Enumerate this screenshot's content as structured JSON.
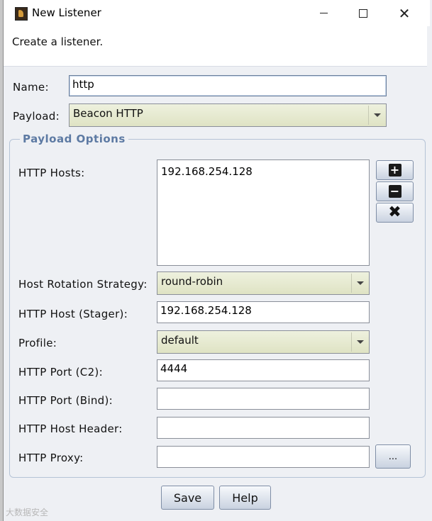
{
  "window": {
    "title": "New Listener",
    "description": "Create a listener."
  },
  "form": {
    "name_label": "Name:",
    "name_value": "http",
    "payload_label": "Payload:",
    "payload_value": "Beacon HTTP"
  },
  "payload_options": {
    "title": "Payload Options",
    "http_hosts_label": "HTTP Hosts:",
    "http_hosts": [
      "192.168.254.128"
    ],
    "host_rotation_label": "Host Rotation Strategy:",
    "host_rotation_value": "round-robin",
    "http_host_stager_label": "HTTP Host (Stager):",
    "http_host_stager_value": "192.168.254.128",
    "profile_label": "Profile:",
    "profile_value": "default",
    "http_port_c2_label": "HTTP Port (C2):",
    "http_port_c2_value": "4444",
    "http_port_bind_label": "HTTP Port (Bind):",
    "http_port_bind_value": "",
    "http_host_header_label": "HTTP Host Header:",
    "http_host_header_value": "",
    "http_proxy_label": "HTTP Proxy:",
    "http_proxy_value": "",
    "proxy_button_label": "..."
  },
  "buttons": {
    "save": "Save",
    "help": "Help"
  },
  "icons": {
    "add": "plus-icon",
    "remove": "minus-icon",
    "clear": "x-icon"
  },
  "watermark": "大数据安全",
  "colors": {
    "group_title": "#5d7aa3",
    "combo_bg": "#dfe3c4"
  }
}
